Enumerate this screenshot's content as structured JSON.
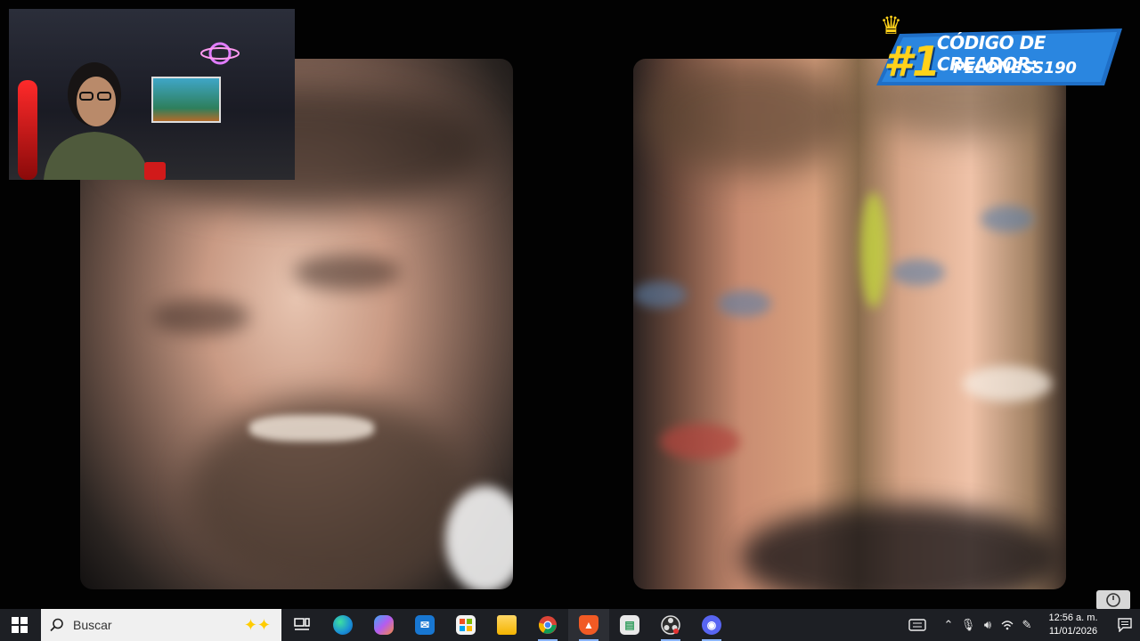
{
  "banner": {
    "rank": "#1",
    "line1": "CÓDIGO DE CREADOR:",
    "line2": "PELONESS190",
    "crown_icon": "crown-icon",
    "bg_color": "#1f6fc7"
  },
  "taskbar": {
    "search_placeholder": "Buscar",
    "apps": [
      {
        "name": "task-view",
        "icon": "task-view-icon"
      },
      {
        "name": "edge",
        "icon": "edge-icon",
        "color": "#1a8fd6"
      },
      {
        "name": "copilot",
        "icon": "copilot-icon",
        "color": "#b45cf0"
      },
      {
        "name": "outlook",
        "icon": "outlook-icon",
        "color": "#1877d2"
      },
      {
        "name": "store",
        "icon": "store-icon",
        "color": "#f3f3f3"
      },
      {
        "name": "file-explorer",
        "icon": "folder-icon",
        "color": "#f4c242"
      },
      {
        "name": "chrome",
        "icon": "chrome-icon",
        "color": "#4caf50"
      },
      {
        "name": "brave",
        "icon": "brave-icon",
        "color": "#f15a24"
      },
      {
        "name": "remote-app",
        "icon": "remote-app-icon",
        "color": "#2e9c5a"
      },
      {
        "name": "obs",
        "icon": "obs-icon",
        "color": "#3a3a3a"
      },
      {
        "name": "discord-canary",
        "icon": "discord-icon",
        "color": "#5865f2"
      }
    ],
    "clock": {
      "time": "12:56 a. m.",
      "date": "11/01/2026"
    }
  }
}
